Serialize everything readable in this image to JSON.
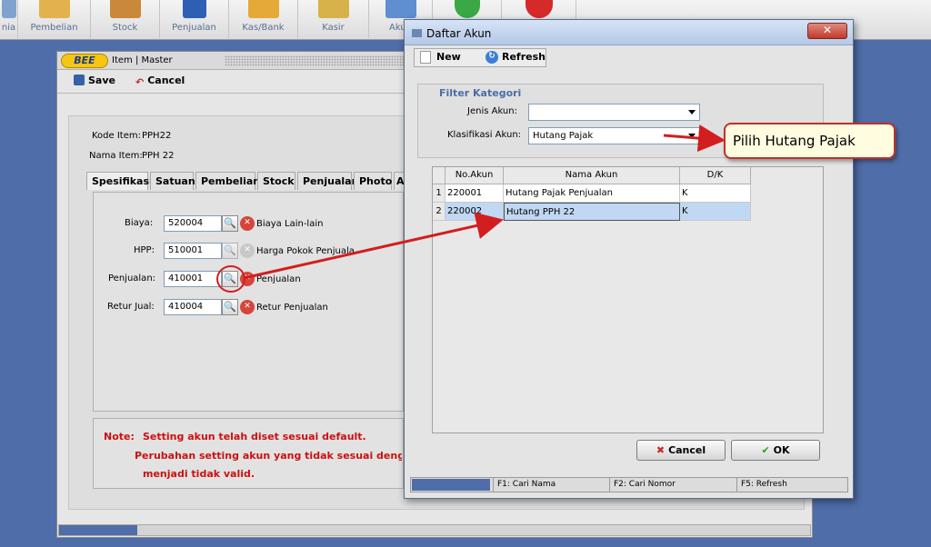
{
  "toolbar": {
    "buttons": [
      {
        "label": "nia",
        "color": "#7fa3cf"
      },
      {
        "label": "Pembelian",
        "color": "#e3b24f"
      },
      {
        "label": "Stock",
        "color": "#c9883a"
      },
      {
        "label": "Penjualan",
        "color": "#2f5fb4"
      },
      {
        "label": "Kas/Bank",
        "color": "#e5a93a"
      },
      {
        "label": "Kasir",
        "color": "#d7b24a"
      },
      {
        "label": "Akun",
        "color": "#5f8fd0"
      },
      {
        "label": "",
        "color": "#3aa845"
      },
      {
        "label": "",
        "color": "#d52a2a"
      }
    ]
  },
  "item_master": {
    "window_title": "Item | Master",
    "logo": "BEE",
    "save_label": "Save",
    "cancel_label": "Cancel",
    "kode_item_label": "Kode Item:",
    "kode_item_value": "PPH22",
    "nama_item_label": "Nama Item:",
    "nama_item_value": "PPH 22",
    "tabs": [
      "Spesifikasi",
      "Satuan",
      "Pembelian",
      "Stock",
      "Penjualan",
      "Photo",
      "A"
    ],
    "fields": [
      {
        "label": "Biaya:",
        "value": "520004",
        "desc": "Biaya Lain-lain"
      },
      {
        "label": "HPP:",
        "value": "510001",
        "desc": "Harga Pokok Penjualan"
      },
      {
        "label": "Penjualan:",
        "value": "410001",
        "desc": "Penjualan"
      },
      {
        "label": "Retur Jual:",
        "value": "410004",
        "desc": "Retur Penjualan"
      }
    ],
    "note_prefix": "Note:",
    "note_line1": "Setting akun telah diset sesuai default.",
    "note_line2": "Perubahan setting akun yang tidak sesuai dengan defa",
    "note_line3": "menjadi tidak valid."
  },
  "dialog": {
    "title": "Daftar Akun",
    "close_label": "✕",
    "new_label": "New",
    "refresh_label": "Refresh",
    "filter_title": "Filter Kategori",
    "jenis_akun_label": "Jenis Akun:",
    "jenis_akun_value": "",
    "klasifikasi_label": "Klasifikasi Akun:",
    "klasifikasi_value": "Hutang Pajak",
    "columns": [
      "No.Akun",
      "Nama Akun",
      "D/K"
    ],
    "rows": [
      {
        "num": "1",
        "no_akun": "220001",
        "nama_akun": "Hutang Pajak Penjualan",
        "dk": "K"
      },
      {
        "num": "2",
        "no_akun": "220002",
        "nama_akun": "Hutang PPH 22",
        "dk": "K"
      }
    ],
    "cancel_label": "Cancel",
    "ok_label": "OK",
    "status": [
      "F1: Cari Nama",
      "F2: Cari Nomor",
      "F5: Refresh"
    ]
  },
  "callout": {
    "text": "Pilih Hutang Pajak"
  }
}
